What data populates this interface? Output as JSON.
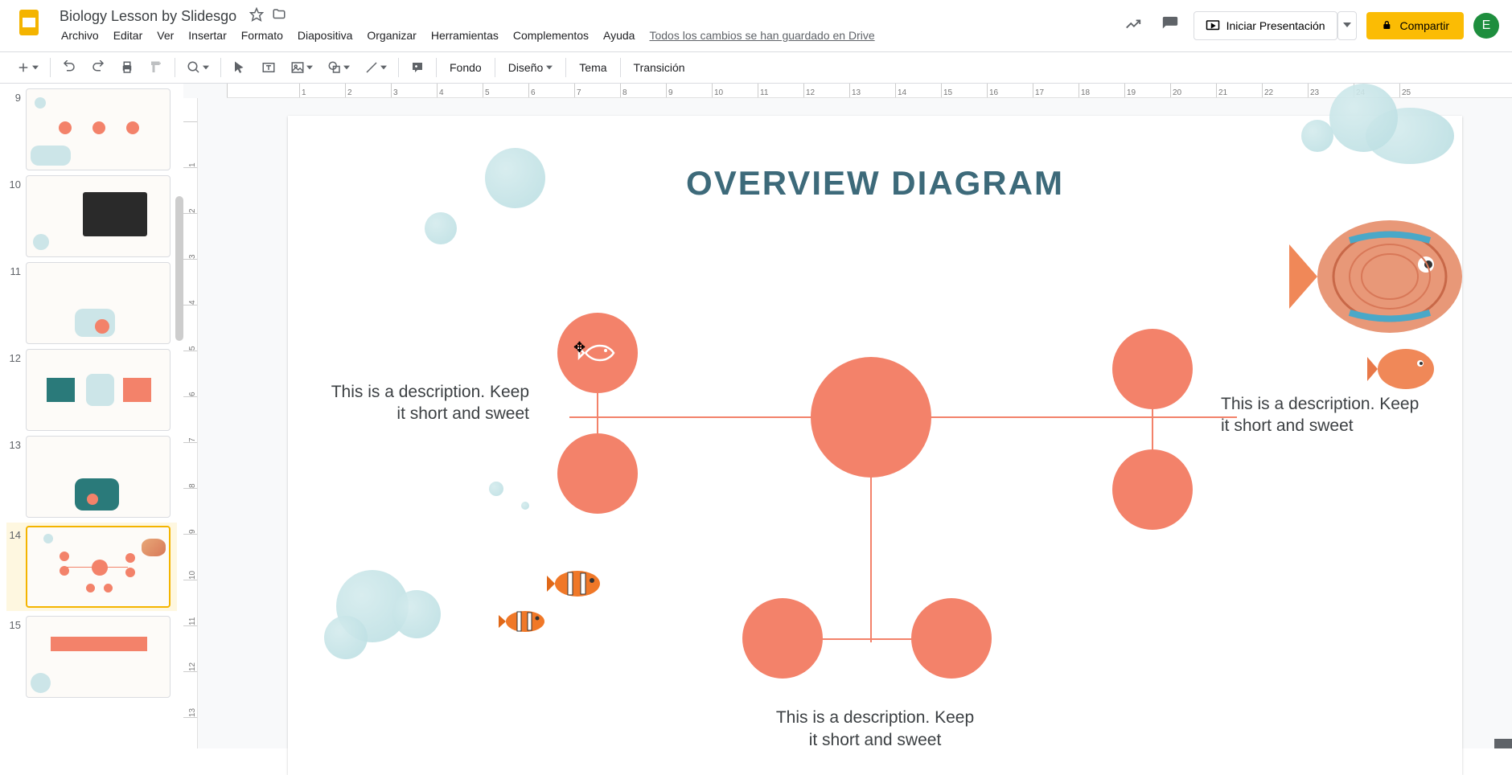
{
  "doc": {
    "title": "Biology Lesson by Slidesgo"
  },
  "menu": {
    "archivo": "Archivo",
    "editar": "Editar",
    "ver": "Ver",
    "insertar": "Insertar",
    "formato": "Formato",
    "diapositiva": "Diapositiva",
    "organizar": "Organizar",
    "herramientas": "Herramientas",
    "complementos": "Complementos",
    "ayuda": "Ayuda",
    "save_status": "Todos los cambios se han guardado en Drive"
  },
  "header": {
    "present": "Iniciar Presentación",
    "share": "Compartir",
    "avatar_letter": "E"
  },
  "toolbar": {
    "fondo": "Fondo",
    "diseno": "Diseño",
    "tema": "Tema",
    "transicion": "Transición"
  },
  "slide": {
    "title": "OVERVIEW DIAGRAM",
    "desc1": "This is a description. Keep it short and sweet",
    "desc2": "This is a description. Keep it short and sweet",
    "desc3": "This is a description. Keep it short and sweet"
  },
  "thumbs": {
    "n9": "9",
    "n10": "10",
    "n11": "11",
    "n12": "12",
    "n13": "13",
    "n14": "14",
    "n15": "15"
  },
  "ruler": {
    "t1": "1",
    "t2": "2",
    "t3": "3",
    "t4": "4",
    "t5": "5",
    "t6": "6",
    "t7": "7",
    "t8": "8",
    "t9": "9",
    "t10": "10",
    "t11": "11",
    "t12": "12",
    "t13": "13",
    "t14": "14",
    "t15": "15",
    "t16": "16",
    "t17": "17",
    "t18": "18",
    "t19": "19",
    "t20": "20",
    "t21": "21",
    "t22": "22",
    "t23": "23",
    "t24": "24",
    "t25": "25"
  }
}
